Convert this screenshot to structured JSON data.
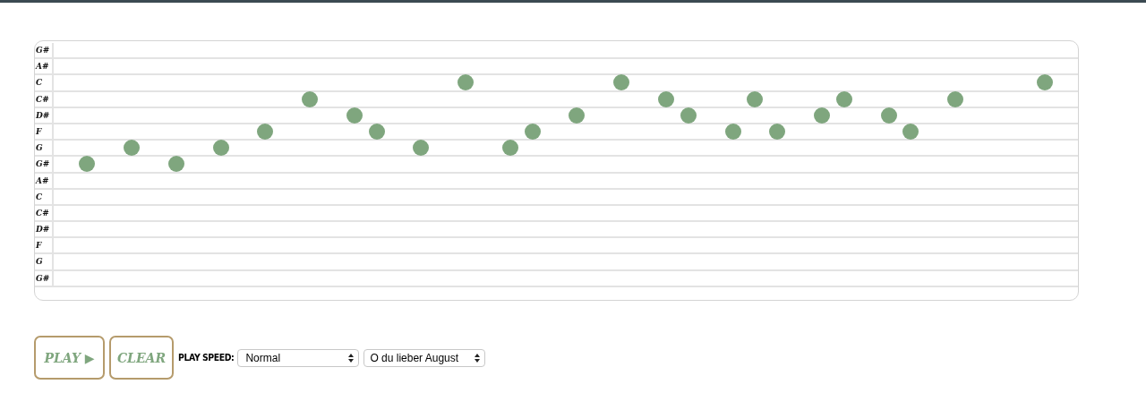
{
  "grid": {
    "rows": [
      {
        "label": "G#"
      },
      {
        "label": "A#"
      },
      {
        "label": "C",
        "steps": [
          {
            "kind": "rest"
          },
          {
            "kind": "rest"
          },
          {
            "kind": "rest"
          },
          {
            "kind": "rest"
          },
          {
            "kind": "rest"
          },
          {
            "kind": "rest"
          },
          {
            "kind": "rest"
          },
          {
            "kind": "rest"
          },
          {
            "kind": "rest"
          },
          {
            "kind": "rest"
          },
          {
            "kind": "rest"
          },
          {
            "kind": "rest"
          },
          {
            "kind": "rest"
          },
          {
            "kind": "rest"
          },
          {
            "kind": "rest"
          },
          {
            "kind": "rest"
          },
          {
            "kind": "rest"
          },
          {
            "kind": "rest"
          },
          {
            "kind": "note"
          },
          {
            "kind": "rest"
          },
          {
            "kind": "rest"
          },
          {
            "kind": "rest"
          },
          {
            "kind": "rest"
          },
          {
            "kind": "rest"
          },
          {
            "kind": "rest"
          },
          {
            "kind": "note"
          },
          {
            "kind": "rest"
          },
          {
            "kind": "rest"
          },
          {
            "kind": "rest"
          },
          {
            "kind": "rest"
          },
          {
            "kind": "rest"
          },
          {
            "kind": "rest"
          },
          {
            "kind": "rest"
          },
          {
            "kind": "rest"
          },
          {
            "kind": "rest"
          },
          {
            "kind": "rest"
          },
          {
            "kind": "rest"
          },
          {
            "kind": "rest"
          },
          {
            "kind": "rest"
          },
          {
            "kind": "rest"
          },
          {
            "kind": "rest"
          },
          {
            "kind": "rest"
          },
          {
            "kind": "rest"
          },
          {
            "kind": "rest"
          },
          {
            "kind": "note"
          }
        ]
      },
      {
        "label": "C#",
        "steps": [
          {
            "kind": "rest"
          },
          {
            "kind": "rest"
          },
          {
            "kind": "rest"
          },
          {
            "kind": "rest"
          },
          {
            "kind": "rest"
          },
          {
            "kind": "rest"
          },
          {
            "kind": "rest"
          },
          {
            "kind": "rest"
          },
          {
            "kind": "rest"
          },
          {
            "kind": "rest"
          },
          {
            "kind": "rest"
          },
          {
            "kind": "note"
          },
          {
            "kind": "rest"
          },
          {
            "kind": "rest"
          },
          {
            "kind": "rest"
          },
          {
            "kind": "rest"
          },
          {
            "kind": "rest"
          },
          {
            "kind": "rest"
          },
          {
            "kind": "rest"
          },
          {
            "kind": "rest"
          },
          {
            "kind": "rest"
          },
          {
            "kind": "rest"
          },
          {
            "kind": "rest"
          },
          {
            "kind": "rest"
          },
          {
            "kind": "rest"
          },
          {
            "kind": "rest"
          },
          {
            "kind": "rest"
          },
          {
            "kind": "note"
          },
          {
            "kind": "rest"
          },
          {
            "kind": "rest"
          },
          {
            "kind": "rest"
          },
          {
            "kind": "note"
          },
          {
            "kind": "rest"
          },
          {
            "kind": "rest"
          },
          {
            "kind": "rest"
          },
          {
            "kind": "note"
          },
          {
            "kind": "rest"
          },
          {
            "kind": "rest"
          },
          {
            "kind": "rest"
          },
          {
            "kind": "rest"
          },
          {
            "kind": "note"
          }
        ]
      },
      {
        "label": "D#",
        "steps": [
          {
            "kind": "rest"
          },
          {
            "kind": "rest"
          },
          {
            "kind": "rest"
          },
          {
            "kind": "rest"
          },
          {
            "kind": "rest"
          },
          {
            "kind": "rest"
          },
          {
            "kind": "rest"
          },
          {
            "kind": "rest"
          },
          {
            "kind": "rest"
          },
          {
            "kind": "rest"
          },
          {
            "kind": "rest"
          },
          {
            "kind": "rest"
          },
          {
            "kind": "rest"
          },
          {
            "kind": "note"
          },
          {
            "kind": "rest"
          },
          {
            "kind": "rest"
          },
          {
            "kind": "rest"
          },
          {
            "kind": "rest"
          },
          {
            "kind": "rest"
          },
          {
            "kind": "rest"
          },
          {
            "kind": "rest"
          },
          {
            "kind": "rest"
          },
          {
            "kind": "rest"
          },
          {
            "kind": "note"
          },
          {
            "kind": "rest"
          },
          {
            "kind": "rest"
          },
          {
            "kind": "rest"
          },
          {
            "kind": "rest"
          },
          {
            "kind": "note"
          },
          {
            "kind": "rest"
          },
          {
            "kind": "rest"
          },
          {
            "kind": "rest"
          },
          {
            "kind": "rest"
          },
          {
            "kind": "rest"
          },
          {
            "kind": "note"
          },
          {
            "kind": "rest"
          },
          {
            "kind": "rest"
          },
          {
            "kind": "note"
          }
        ]
      },
      {
        "label": "F",
        "steps": [
          {
            "kind": "rest"
          },
          {
            "kind": "rest"
          },
          {
            "kind": "rest"
          },
          {
            "kind": "rest"
          },
          {
            "kind": "rest"
          },
          {
            "kind": "rest"
          },
          {
            "kind": "rest"
          },
          {
            "kind": "rest"
          },
          {
            "kind": "rest"
          },
          {
            "kind": "note"
          },
          {
            "kind": "rest"
          },
          {
            "kind": "rest"
          },
          {
            "kind": "rest"
          },
          {
            "kind": "rest"
          },
          {
            "kind": "note"
          },
          {
            "kind": "rest"
          },
          {
            "kind": "rest"
          },
          {
            "kind": "rest"
          },
          {
            "kind": "rest"
          },
          {
            "kind": "rest"
          },
          {
            "kind": "rest"
          },
          {
            "kind": "note"
          },
          {
            "kind": "rest"
          },
          {
            "kind": "rest"
          },
          {
            "kind": "rest"
          },
          {
            "kind": "rest"
          },
          {
            "kind": "rest"
          },
          {
            "kind": "rest"
          },
          {
            "kind": "rest"
          },
          {
            "kind": "rest"
          },
          {
            "kind": "note"
          },
          {
            "kind": "rest"
          },
          {
            "kind": "note"
          },
          {
            "kind": "rest"
          },
          {
            "kind": "rest"
          },
          {
            "kind": "rest"
          },
          {
            "kind": "rest"
          },
          {
            "kind": "rest"
          },
          {
            "kind": "note"
          }
        ]
      },
      {
        "label": "G",
        "steps": [
          {
            "kind": "rest"
          },
          {
            "kind": "rest"
          },
          {
            "kind": "rest"
          },
          {
            "kind": "note"
          },
          {
            "kind": "rest"
          },
          {
            "kind": "rest"
          },
          {
            "kind": "rest"
          },
          {
            "kind": "note"
          },
          {
            "kind": "rest"
          },
          {
            "kind": "rest"
          },
          {
            "kind": "rest"
          },
          {
            "kind": "rest"
          },
          {
            "kind": "rest"
          },
          {
            "kind": "rest"
          },
          {
            "kind": "rest"
          },
          {
            "kind": "rest"
          },
          {
            "kind": "note"
          },
          {
            "kind": "rest"
          },
          {
            "kind": "rest"
          },
          {
            "kind": "rest"
          },
          {
            "kind": "note"
          }
        ]
      },
      {
        "label": "G#",
        "steps": [
          {
            "kind": "rest"
          },
          {
            "kind": "note"
          },
          {
            "kind": "rest"
          },
          {
            "kind": "rest"
          },
          {
            "kind": "rest"
          },
          {
            "kind": "note"
          }
        ]
      },
      {
        "label": "A#"
      },
      {
        "label": "C"
      },
      {
        "label": "C#"
      },
      {
        "label": "D#"
      },
      {
        "label": "F"
      },
      {
        "label": "G"
      },
      {
        "label": "G#"
      }
    ]
  },
  "controls": {
    "play_button": "PLAY ▶",
    "clear_button": "CLEAR",
    "speed_label": "PLAY SPEED:",
    "speed_select": "Normal",
    "song_select": "O du lieber August"
  }
}
